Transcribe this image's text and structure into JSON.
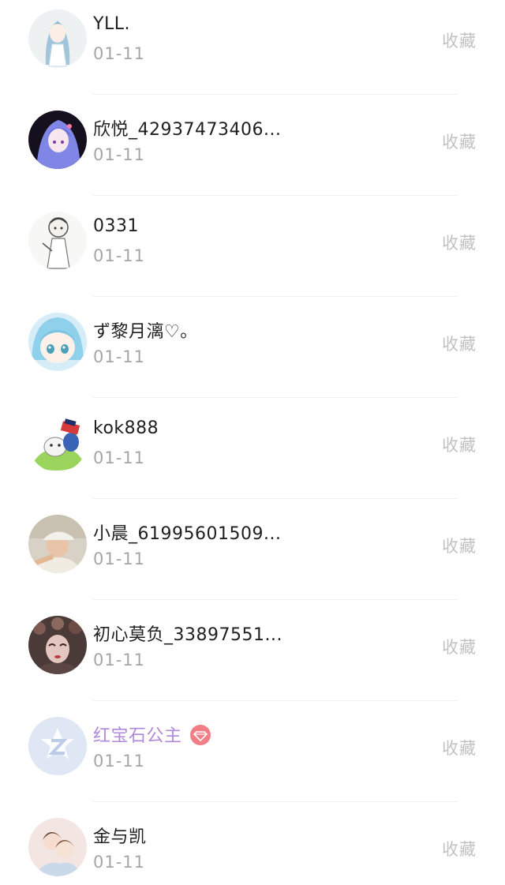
{
  "list": {
    "items": [
      {
        "name": "YLL.",
        "date": "01-11",
        "action": "收藏",
        "avatar": "anime-girl-blue-hair-avatar"
      },
      {
        "name": "欣悦_42937473406...",
        "date": "01-11",
        "action": "收藏",
        "avatar": "anime-girl-purple-avatar"
      },
      {
        "name": "0331",
        "date": "01-11",
        "action": "收藏",
        "avatar": "sketch-character-avatar"
      },
      {
        "name": "ず黎月漓♡。",
        "date": "01-11",
        "action": "收藏",
        "avatar": "chibi-blue-hair-avatar"
      },
      {
        "name": "kok888",
        "date": "01-11",
        "action": "收藏",
        "avatar": "cartoon-penguin-avatar"
      },
      {
        "name": "小晨_61995601509...",
        "date": "01-11",
        "action": "收藏",
        "avatar": "person-with-cap-avatar"
      },
      {
        "name": "初心莫负_33897551...",
        "date": "01-11",
        "action": "收藏",
        "avatar": "opera-face-avatar"
      },
      {
        "name": "红宝石公主",
        "date": "01-11",
        "action": "收藏",
        "avatar": "default-z-avatar",
        "vip": true,
        "badge": "ruby-gem-icon",
        "name_color": "#b08ad8"
      },
      {
        "name": "金与凯",
        "date": "01-11",
        "action": "收藏",
        "avatar": "couple-illustration-avatar"
      }
    ]
  }
}
